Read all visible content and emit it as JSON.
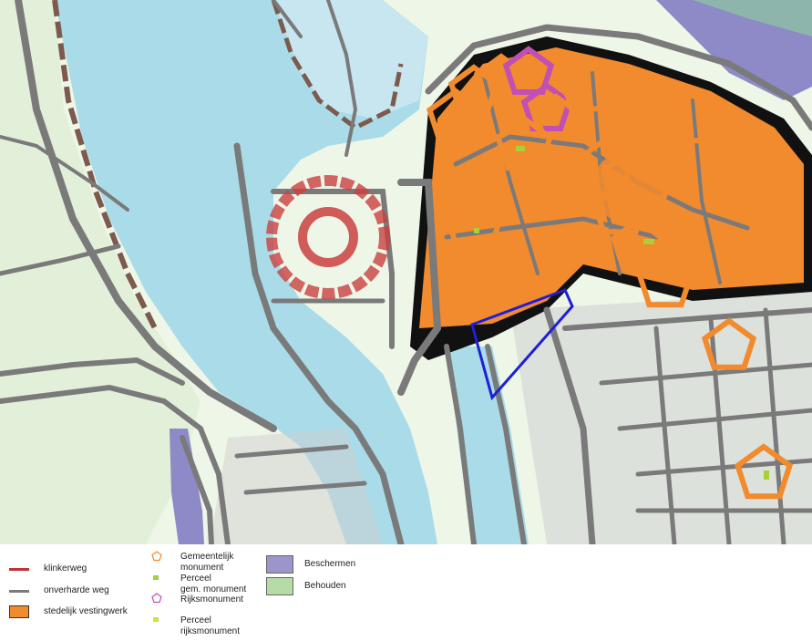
{
  "legend": {
    "items": [
      {
        "id": "klinkerweg",
        "label": "klinkerweg",
        "color": "#c0323a",
        "symbol": "line"
      },
      {
        "id": "onverharde-weg",
        "label": "onverharde weg",
        "color": "#7a7a7a",
        "symbol": "line"
      },
      {
        "id": "stedelijk-vestingwerk",
        "label": "stedelijk vestingwerk",
        "color": "#f28a2e",
        "symbol": "box"
      },
      {
        "id": "gemeentelijk-monument",
        "label_lines": [
          "Gemeentelijk",
          "monument"
        ],
        "color": "#f28a2e",
        "symbol": "pentagon-outline"
      },
      {
        "id": "perceel-gem-monument",
        "label_lines": [
          "Perceel",
          "gem. monument"
        ],
        "color": "#a9cf3a",
        "symbol": "square"
      },
      {
        "id": "rijksmonument",
        "label": "Rijksmonument",
        "color": "#c24fb4",
        "symbol": "pentagon-outline"
      },
      {
        "id": "perceel-rijksmonument",
        "label_lines": [
          "Perceel",
          "rijksmonument"
        ],
        "color": "#c7e83a",
        "symbol": "square"
      },
      {
        "id": "beschermen",
        "label": "Beschermen",
        "color": "#9a96cc",
        "symbol": "box"
      },
      {
        "id": "behouden",
        "label": "Behouden",
        "color": "#b7dba5",
        "symbol": "box"
      }
    ]
  },
  "map": {
    "colors": {
      "water": "#a9dbe8",
      "water_light": "#c7e6ef",
      "land_green": "#e3f0d9",
      "land_pale": "#eef6e8",
      "bank_brown": "#7d5a4e",
      "road_gray": "#7a7a7a",
      "road_light": "#cfcfcf",
      "fort_orange": "#f28a2e",
      "monument_purple": "#c24fb4",
      "plan_blue": "#1f1fd6",
      "protect_purple": "#8d8ac7",
      "keep_green": "#8fc7a0",
      "dark": "#111111",
      "red_ring": "#c9413f"
    }
  }
}
